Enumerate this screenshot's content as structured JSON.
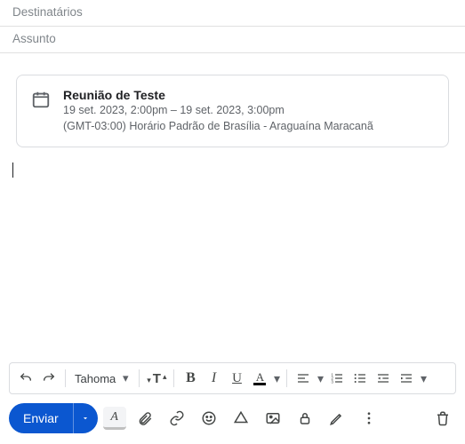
{
  "fields": {
    "recipients_placeholder": "Destinatários",
    "subject_placeholder": "Assunto"
  },
  "event": {
    "title": "Reunião de Teste",
    "time_range": "19 set. 2023, 2:00pm – 19 set. 2023, 3:00pm",
    "timezone_location": "(GMT-03:00) Horário Padrão de Brasília - Araguaína Maracanã"
  },
  "toolbar": {
    "font_name": "Tahoma",
    "bold_label": "B",
    "italic_label": "I",
    "underline_label": "U",
    "text_color_label": "A",
    "text_size_label": "T"
  },
  "send": {
    "label": "Enviar",
    "highlight_label": "A"
  }
}
